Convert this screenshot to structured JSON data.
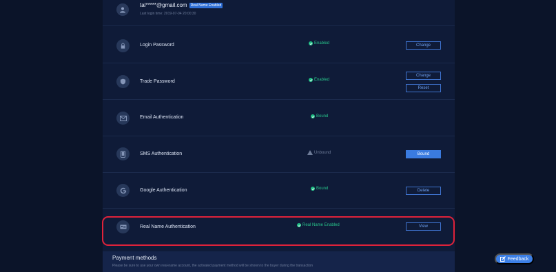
{
  "user": {
    "email": "tal*****@gmail.com",
    "badge": "Real Name Enabled",
    "last_login": "Last login time: 2019-07-04 20:00:30"
  },
  "security_items": [
    {
      "label": "Login Password",
      "icon": "lock-icon",
      "status": "Enabled",
      "status_type": "ok",
      "buttons": [
        "Change"
      ]
    },
    {
      "label": "Trade Password",
      "icon": "shield-icon",
      "status": "Enabled",
      "status_type": "ok",
      "buttons": [
        "Change",
        "Reset"
      ]
    },
    {
      "label": "Email Authentication",
      "icon": "mail-icon",
      "status": "Bound",
      "status_type": "ok",
      "buttons": []
    },
    {
      "label": "SMS Authentication",
      "icon": "phone-icon",
      "status": "Unbound",
      "status_type": "warn",
      "buttons": [
        "Bound"
      ]
    },
    {
      "label": "Google Authentication",
      "icon": "google-icon",
      "status": "Bound",
      "status_type": "ok",
      "buttons": [
        "Delete"
      ]
    },
    {
      "label": "Real Name Authentication",
      "icon": "id-card-icon",
      "status": "Real Name Enabled",
      "status_type": "ok",
      "buttons": [
        "View"
      ]
    }
  ],
  "payment": {
    "title": "Payment methods",
    "note": "Please be sure to use your own real-name account, the activated payment method will be shown to the buyer during the transaction"
  },
  "feedback": {
    "label": "Feedback"
  },
  "colors": {
    "accent": "#3a7be0",
    "success": "#1fbf85",
    "highlight": "#e0223a",
    "background": "#0b1429"
  }
}
